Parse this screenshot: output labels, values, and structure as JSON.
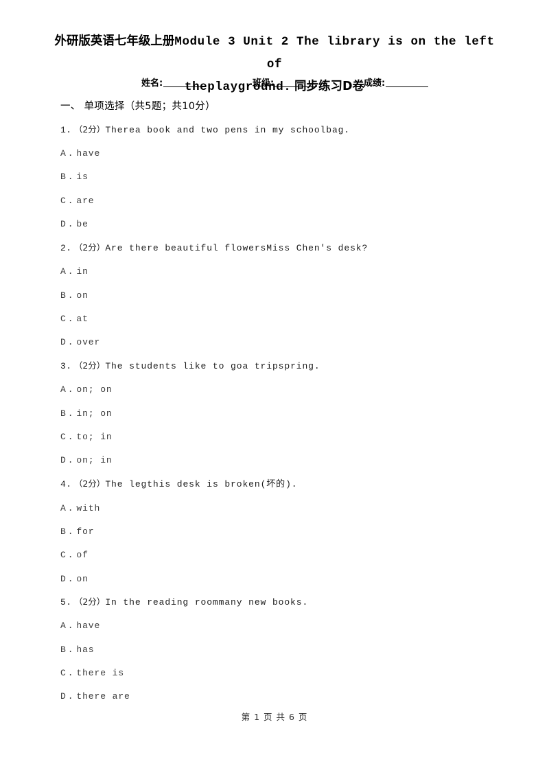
{
  "document": {
    "title_line1_cjk_prefix": "外研版英语七年级上册",
    "title_line1_latin": "Module 3 Unit 2 The library is on the left of",
    "title_line2_latin": "theplayground.",
    "title_line2_cjk": "同步练习D卷",
    "footer": "第 1 页 共 6 页"
  },
  "info_fields": {
    "name_label": "姓名:",
    "class_label": "班级:",
    "score_label": "成绩:"
  },
  "section": {
    "heading": "一、 单项选择（共5题；共10分）"
  },
  "questions": [
    {
      "number": "1.",
      "score": "（2分）",
      "stem_before": "There",
      "stem_after": "a book and two pens in my schoolbag.",
      "options": [
        {
          "key": "A",
          "sep": ".",
          "text": "have"
        },
        {
          "key": "B",
          "sep": ".",
          "text": "is"
        },
        {
          "key": "C",
          "sep": ".",
          "text": "are"
        },
        {
          "key": "D",
          "sep": ".",
          "text": "be"
        }
      ]
    },
    {
      "number": "2.",
      "score": "（2分）",
      "stem_before": "Are there beautiful flowers",
      "stem_after": "Miss Chen's desk?",
      "options": [
        {
          "key": "A",
          "sep": ".",
          "text": "in"
        },
        {
          "key": "B",
          "sep": ".",
          "text": "on"
        },
        {
          "key": "C",
          "sep": ".",
          "text": "at"
        },
        {
          "key": "D",
          "sep": ".",
          "text": "over"
        }
      ]
    },
    {
      "number": "3.",
      "score": "（2分）",
      "stem_part1": "The students like to go",
      "stem_part2": "a trip",
      "stem_part3": "spring.",
      "options": [
        {
          "key": "A",
          "sep": ".",
          "text": "on; on"
        },
        {
          "key": "B",
          "sep": ".",
          "text": "in; on"
        },
        {
          "key": "C",
          "sep": ".",
          "text": "to; in"
        },
        {
          "key": "D",
          "sep": ".",
          "text": "on; in"
        }
      ]
    },
    {
      "number": "4.",
      "score": "（2分）",
      "stem_before": "The leg",
      "stem_after": "this desk is broken",
      "stem_zh": "(坏的).",
      "options": [
        {
          "key": "A",
          "sep": ".",
          "text": "with"
        },
        {
          "key": "B",
          "sep": ".",
          "text": "for"
        },
        {
          "key": "C",
          "sep": ".",
          "text": "of"
        },
        {
          "key": "D",
          "sep": ".",
          "text": "on"
        }
      ]
    },
    {
      "number": "5.",
      "score": "（2分）",
      "stem_before": "In the reading room",
      "stem_after": "many new books.",
      "options": [
        {
          "key": "A",
          "sep": ".",
          "text": "have"
        },
        {
          "key": "B",
          "sep": ".",
          "text": "has"
        },
        {
          "key": "C",
          "sep": ".",
          "text": "there is"
        },
        {
          "key": "D",
          "sep": ".",
          "text": "there are"
        }
      ]
    }
  ]
}
